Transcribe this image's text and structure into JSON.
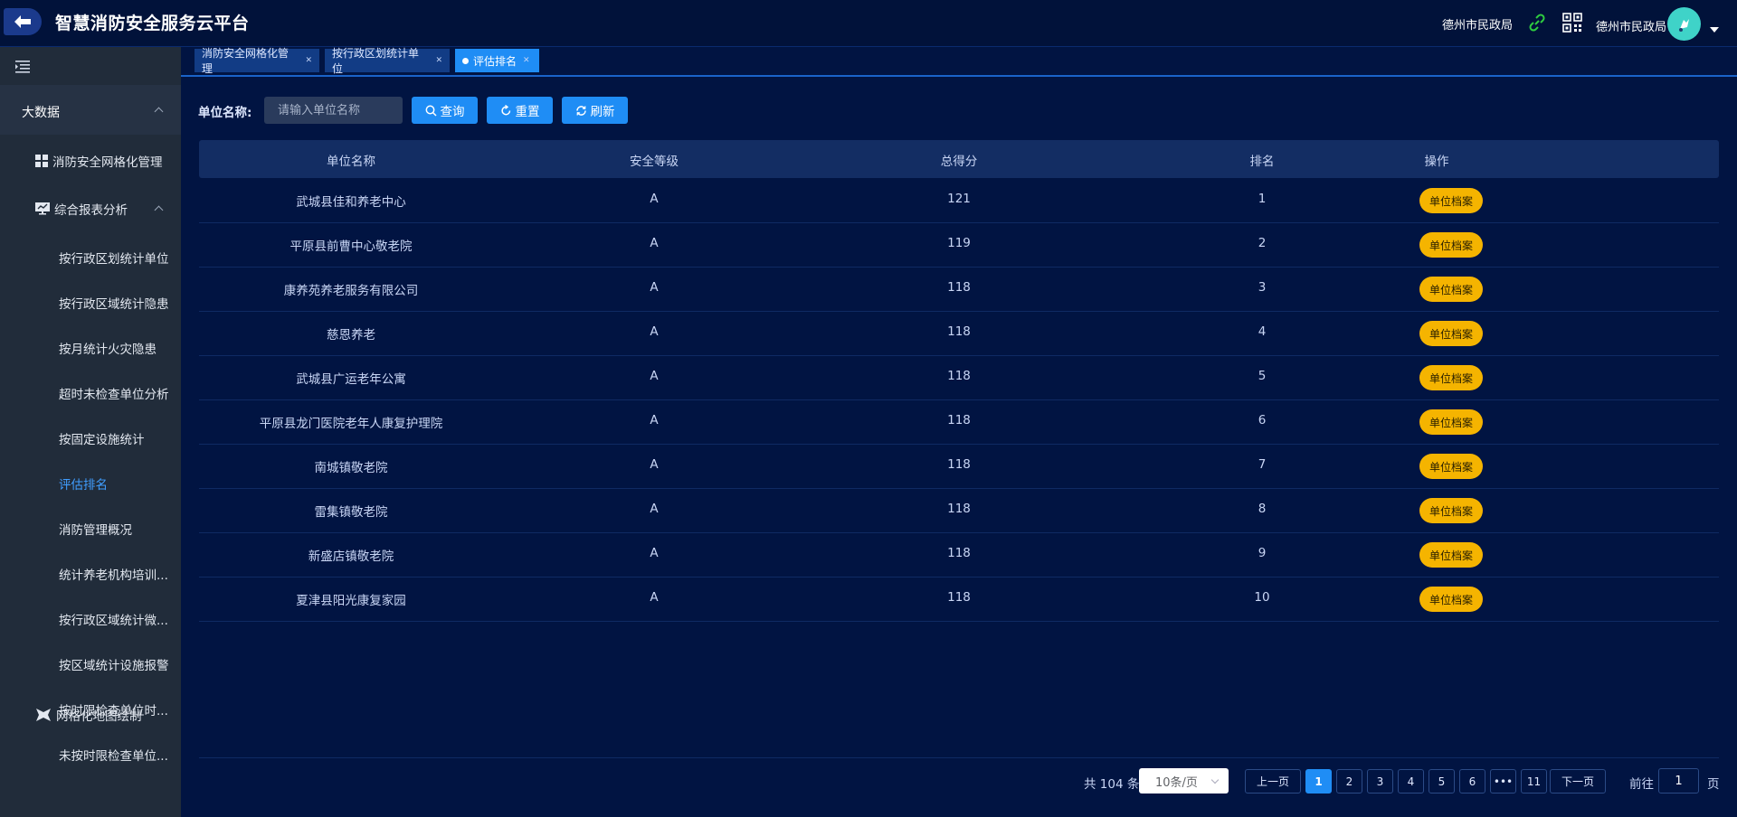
{
  "app": {
    "title": "智慧消防安全服务云平台"
  },
  "header": {
    "org": "德州市民政局",
    "user": "德州市民政局"
  },
  "sidebar": {
    "group": "大数据",
    "items": {
      "grid": "消防安全网格化管理",
      "report": "综合报表分析",
      "map": "网格化地图绘制"
    },
    "sub_items": [
      "按行政区划统计单位",
      "按行政区域统计隐患",
      "按月统计火灾隐患",
      "超时未检查单位分析",
      "按固定设施统计",
      "评估排名",
      "消防管理概况",
      "统计养老机构培训...",
      "按行政区域统计微...",
      "按区域统计设施报警",
      "按时限检查单位时...",
      "未按时限检查单位..."
    ],
    "active_sub": "评估排名"
  },
  "tabs": [
    {
      "label": "消防安全网格化管理",
      "active": false
    },
    {
      "label": "按行政区划统计单位",
      "active": false
    },
    {
      "label": "评估排名",
      "active": true
    }
  ],
  "filter": {
    "label": "单位名称:",
    "placeholder": "请输入单位名称",
    "query": "查询",
    "reset": "重置",
    "refresh": "刷新"
  },
  "table": {
    "columns": [
      "单位名称",
      "安全等级",
      "总得分",
      "排名",
      "操作"
    ],
    "action_label": "单位档案",
    "rows": [
      {
        "name": "武城县佳和养老中心",
        "level": "A",
        "score": "121",
        "rank": "1"
      },
      {
        "name": "平原县前曹中心敬老院",
        "level": "A",
        "score": "119",
        "rank": "2"
      },
      {
        "name": "康养苑养老服务有限公司",
        "level": "A",
        "score": "118",
        "rank": "3"
      },
      {
        "name": "慈恩养老",
        "level": "A",
        "score": "118",
        "rank": "4"
      },
      {
        "name": "武城县广运老年公寓",
        "level": "A",
        "score": "118",
        "rank": "5"
      },
      {
        "name": "平原县龙门医院老年人康复护理院",
        "level": "A",
        "score": "118",
        "rank": "6"
      },
      {
        "name": "南城镇敬老院",
        "level": "A",
        "score": "118",
        "rank": "7"
      },
      {
        "name": "雷集镇敬老院",
        "level": "A",
        "score": "118",
        "rank": "8"
      },
      {
        "name": "新盛店镇敬老院",
        "level": "A",
        "score": "118",
        "rank": "9"
      },
      {
        "name": "夏津县阳光康复家园",
        "level": "A",
        "score": "118",
        "rank": "10"
      }
    ]
  },
  "pagination": {
    "total": "共 104 条",
    "page_size": "10条/页",
    "prev": "上一页",
    "next": "下一页",
    "pages": [
      "1",
      "2",
      "3",
      "4",
      "5",
      "6",
      "•••",
      "11"
    ],
    "current": "1",
    "jump_label": "前往",
    "jump_value": "1",
    "jump_unit": "页"
  },
  "colors": {
    "accent": "#1f8df5",
    "archive_button": "#f5b400",
    "background": "#011442"
  }
}
